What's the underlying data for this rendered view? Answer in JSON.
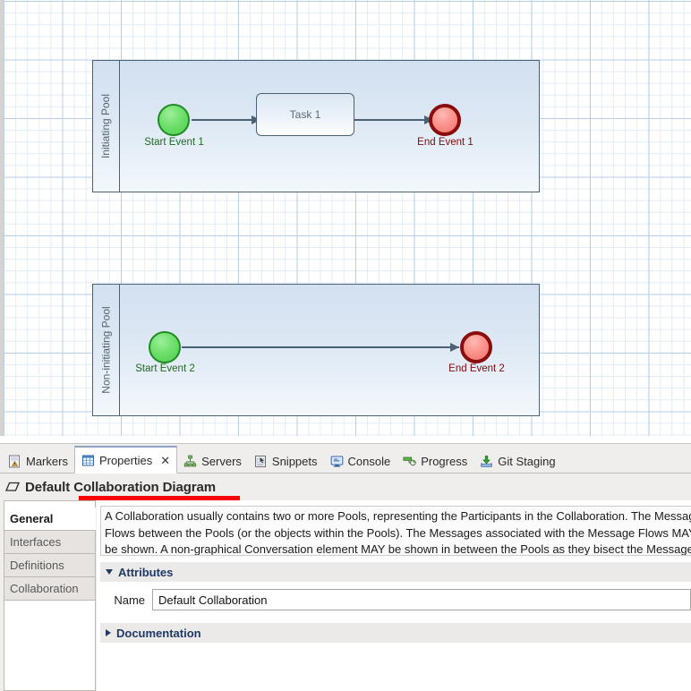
{
  "canvas": {
    "pools": [
      {
        "id": "pool-initiating",
        "label": "Initiating Pool",
        "elements": {
          "start_event": "Start Event 1",
          "task": "Task 1",
          "end_event": "End Event 1"
        }
      },
      {
        "id": "pool-non-initiating",
        "label": "Non-initiating Pool",
        "elements": {
          "start_event": "Start Event 2",
          "end_event": "End Event 2"
        }
      }
    ]
  },
  "bottom_panel": {
    "tabs": [
      {
        "label": "Markers",
        "icon": "markers-icon",
        "active": false,
        "closable": false
      },
      {
        "label": "Properties",
        "icon": "properties-icon",
        "active": true,
        "closable": true,
        "close_glyph": "✕"
      },
      {
        "label": "Servers",
        "icon": "servers-icon",
        "active": false,
        "closable": false
      },
      {
        "label": "Snippets",
        "icon": "snippets-icon",
        "active": false,
        "closable": false
      },
      {
        "label": "Console",
        "icon": "console-icon",
        "active": false,
        "closable": false
      },
      {
        "label": "Progress",
        "icon": "progress-icon",
        "active": false,
        "closable": false
      },
      {
        "label": "Git Staging",
        "icon": "git-staging-icon",
        "active": false,
        "closable": false
      }
    ],
    "title": {
      "prefix": "Default ",
      "highlighted": "Collaboration Diagram",
      "icon": "collaboration-diagram-icon"
    },
    "side_tabs": [
      {
        "label": "General",
        "selected": true
      },
      {
        "label": "Interfaces",
        "selected": false
      },
      {
        "label": "Definitions",
        "selected": false
      },
      {
        "label": "Collaboration",
        "selected": false
      }
    ],
    "description": "A Collaboration usually contains two or more Pools, representing the Participants in the Collaboration. The Message Flows between the Pools (or the objects within the Pools). The Messages associated with the Message Flows MAY also be shown. A non-graphical Conversation element MAY be shown in between the Pools as they bisect the Message Flows between the Pools. Al",
    "sections": {
      "attributes": {
        "title": "Attributes",
        "expanded": true
      },
      "documentation": {
        "title": "Documentation",
        "expanded": false
      }
    },
    "form": {
      "name_label": "Name",
      "name_value": "Default Collaboration",
      "name_placeholder": ""
    }
  },
  "colors": {
    "start_event_fill": "#6fe06c",
    "start_event_border": "#1f8a26",
    "end_event_fill": "#fa958d",
    "end_event_border": "#8a0d0d",
    "pool_fill": "#dde8f4",
    "pool_border": "#4a6176",
    "connection": "#4a6176",
    "section_title": "#1f3864",
    "annotation_underline": "#fe0000",
    "grid_line": "#b9cfe8"
  }
}
